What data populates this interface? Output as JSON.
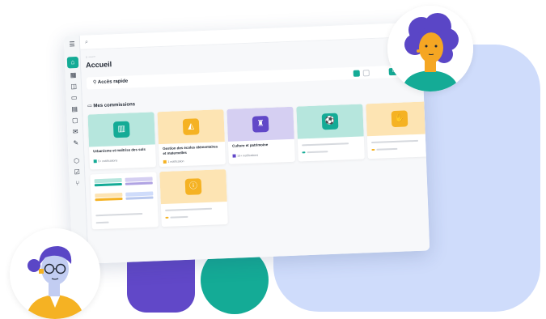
{
  "colors": {
    "teal": "#14ab96",
    "teal_light": "#b6e6dd",
    "purple": "#6148c8",
    "purple_light": "#d5cff2",
    "yellow": "#f5b223",
    "yellow_light": "#fde4b3",
    "background_blue": "#cfdcfb"
  },
  "page": {
    "title": "Accueil"
  },
  "quick_access": {
    "label": "Accès rapide",
    "create_button": "Créer un espace"
  },
  "section": {
    "title": "Mes commissions"
  },
  "cards": [
    {
      "title": "Urbanisme et maîtrise des sols",
      "subtitle": "5+ notifications",
      "icon": "building-icon"
    },
    {
      "title": "Gestion des écoles élémentaires et maternelles",
      "subtitle": "1 notification",
      "icon": "graduation-cap-icon"
    },
    {
      "title": "Culture et patrimoine",
      "subtitle": "10+ notifications",
      "icon": "monument-icon"
    },
    {
      "title": "",
      "subtitle": "",
      "icon": "soccer-ball-icon"
    },
    {
      "title": "",
      "subtitle": "",
      "icon": "hand-icon"
    },
    {
      "title": "",
      "subtitle": "",
      "icon": "info-icon"
    }
  ]
}
